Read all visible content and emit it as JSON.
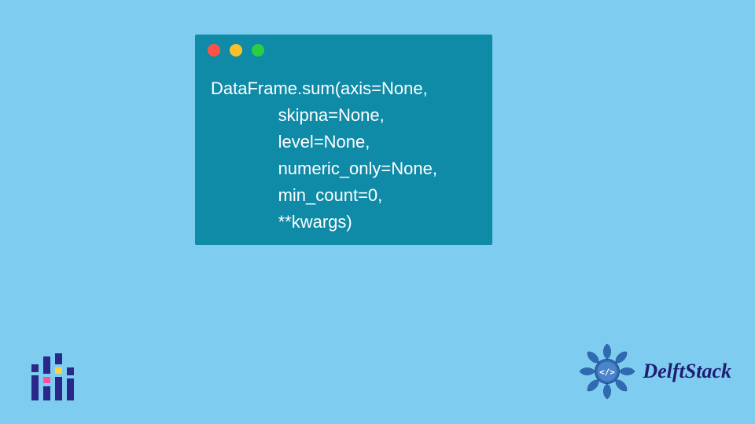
{
  "window": {
    "dots": {
      "red": "#ff5244",
      "yellow": "#ffbf2b",
      "green": "#2bce41"
    }
  },
  "code": {
    "lines": [
      "DataFrame.sum(axis=None,",
      "              skipna=None,",
      "              level=None,",
      "              numeric_only=None,",
      "              min_count=0,",
      "              **kwargs)"
    ]
  },
  "brand": {
    "name": "DelftStack"
  },
  "colors": {
    "background": "#7ecdf0",
    "window": "#0f8ba8",
    "code_text": "#ffffff",
    "logo_primary": "#2a2888"
  }
}
